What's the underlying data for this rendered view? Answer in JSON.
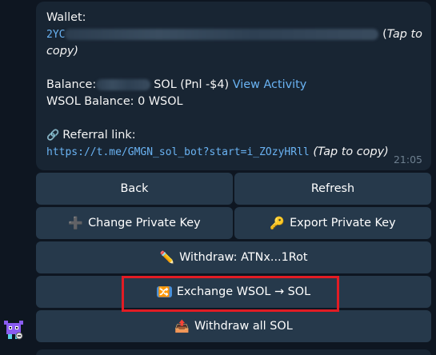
{
  "message": {
    "wallet_label": "Wallet:",
    "wallet_address_prefix": "2YC",
    "tap_to": "Tap to",
    "copy_close": "copy)",
    "open_paren": "(",
    "balance_label": "Balance:",
    "balance_suffix": "SOL (Pnl -$4)",
    "view_activity": "View Activity",
    "wsol_balance": "WSOL Balance: 0 WSOL",
    "referral_label": "Referral link:",
    "referral_url": "https://t.me/GMGN_sol_bot?start=i_ZOzyHRll",
    "tap_to_copy": "(Tap to copy)",
    "time": "21:05"
  },
  "buttons": {
    "back": "Back",
    "refresh": "Refresh",
    "change_private_key": "Change Private Key",
    "export_private_key": "Export Private Key",
    "withdraw": "Withdraw: ATNx...1Rot",
    "exchange": "Exchange WSOL → SOL",
    "withdraw_all": "Withdraw all SOL"
  },
  "icons": {
    "referral": "link-icon",
    "change_private_key": "plus-icon",
    "export_private_key": "key-icon",
    "withdraw": "pencil-icon",
    "exchange": "shuffle-icon",
    "withdraw_all": "outbox-tray-icon",
    "avatar": "bot-avatar-icon"
  },
  "colors": {
    "background": "#0e1621",
    "bubble": "#182533",
    "button": "#26394b",
    "link": "#6ab3f3",
    "highlight": "#e21c24"
  }
}
